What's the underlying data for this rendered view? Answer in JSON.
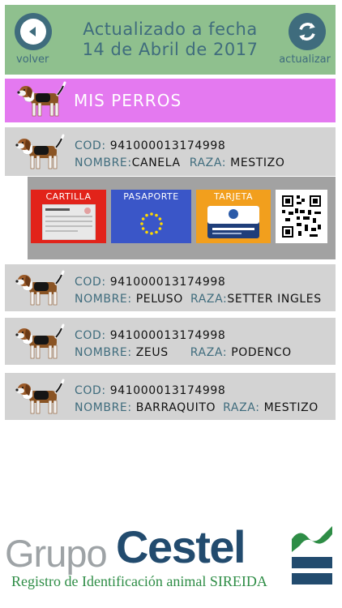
{
  "header": {
    "back_label": "volver",
    "refresh_label": "actualizar",
    "title_line1": "Actualizado a fecha",
    "title_line2": "14 de Abril de 2017"
  },
  "section": {
    "title": "MIS PERROS"
  },
  "field_labels": {
    "cod": "COD:",
    "nombre": "NOMBRE:",
    "raza": "RAZA:"
  },
  "dogs": [
    {
      "cod": "941000013174998",
      "nombre": "CANELA",
      "raza": "MESTIZO"
    },
    {
      "cod": "941000013174998",
      "nombre": "PELUSO",
      "raza": "SETTER INGLES"
    },
    {
      "cod": "941000013174998",
      "nombre": "ZEUS",
      "raza": "PODENCO"
    },
    {
      "cod": "941000013174998",
      "nombre": "BARRAQUITO",
      "raza": "MESTIZO"
    }
  ],
  "documents": [
    {
      "label": "CARTILLA",
      "color": "#e2231a"
    },
    {
      "label": "PASAPORTE",
      "color": "#3a56c8"
    },
    {
      "label": "TARJETA",
      "color": "#f29f1d"
    }
  ],
  "brand": {
    "part1": "Grupo",
    "part2": "Cestel",
    "subtitle": "Registro de Identificación animal SIREIDA"
  },
  "colors": {
    "header_bg": "#8fc08e",
    "accent": "#3f6c7d",
    "section_bg": "#e479f0",
    "row_bg": "#d3d3d3",
    "panel_bg": "#a2a2a2"
  },
  "icons": [
    "back-arrow-icon",
    "refresh-icon",
    "beagle-dog-icon",
    "qr-code-icon",
    "eu-stars-icon"
  ]
}
